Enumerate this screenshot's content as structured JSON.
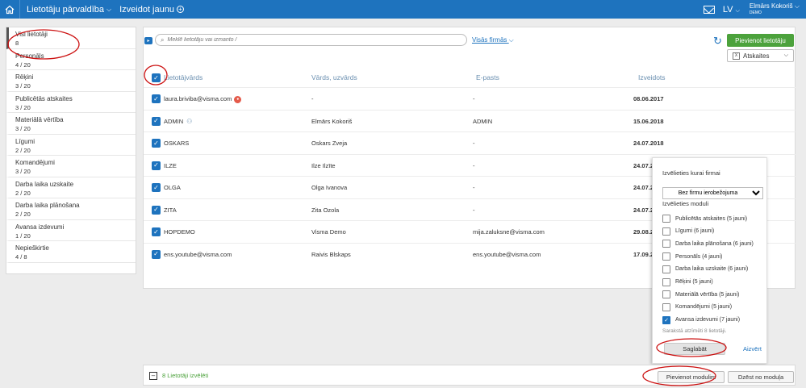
{
  "topbar": {
    "app_title": "Lietotāju pārvaldība",
    "create_new": "Izveidot jaunu",
    "language": "LV",
    "user_name": "Elmārs Kokoriš",
    "user_sub": "DEMO"
  },
  "sidebar": {
    "items": [
      {
        "label": "Visi lietotāji",
        "count": "8"
      },
      {
        "label": "Personāls",
        "count": "4 / 20"
      },
      {
        "label": "Rēķini",
        "count": "3 / 20"
      },
      {
        "label": "Publicētās atskaites",
        "count": "3 / 20"
      },
      {
        "label": "Materiālā vērtība",
        "count": "3 / 20"
      },
      {
        "label": "Līgumi",
        "count": "2 / 20"
      },
      {
        "label": "Komandējumi",
        "count": "3 / 20"
      },
      {
        "label": "Darba laika uzskaite",
        "count": "2 / 20"
      },
      {
        "label": "Darba laika plānošana",
        "count": "2 / 20"
      },
      {
        "label": "Avansa izdevumi",
        "count": "1 / 20"
      },
      {
        "label": "Nepieškirtie",
        "count": "4 / 8"
      }
    ]
  },
  "toolbar": {
    "search_placeholder": "Meklē lietotāju vai izmanto /",
    "all_firms": "Visās firmās",
    "add_user": "Pievienot lietotāju",
    "reports": "Atskaites"
  },
  "table": {
    "headers": {
      "user": "Lietotājvārds",
      "name": "Vārds, uzvārds",
      "email": "E-pasts",
      "created": "Izveidots"
    },
    "rows": [
      {
        "user": "laura.briviba@visma.com",
        "name": "-",
        "email": "-",
        "created": "08.06.2017"
      },
      {
        "user": "ADMIN",
        "name": "Elmārs Kokoriš",
        "email": "ADMIN",
        "created": "15.06.2018"
      },
      {
        "user": "OSKARS",
        "name": "Oskars Zveja",
        "email": "-",
        "created": "24.07.2018"
      },
      {
        "user": "ILZE",
        "name": "Ilze Ilzīte",
        "email": "-",
        "created": "24.07.20"
      },
      {
        "user": "OLGA",
        "name": "Olga Ivanova",
        "email": "-",
        "created": "24.07.20"
      },
      {
        "user": "ZITA",
        "name": "Zita Ozola",
        "email": "-",
        "created": "24.07.20"
      },
      {
        "user": "HOPDEMO",
        "name": "Visma Demo",
        "email": "mija.zaluksne@visma.com",
        "created": "29.08.20"
      },
      {
        "user": "ens.youtube@visma.com",
        "name": "Raivis Blskaps",
        "email": "ens.youtube@visma.com",
        "created": "17.09.20"
      }
    ]
  },
  "popup": {
    "firm_heading": "Izvēlieties kurai firmai",
    "firm_select": "Bez firmu ierobežojuma",
    "module_heading": "Izvēlieties moduli",
    "modules": [
      {
        "label": "Publicētās atskaites (5 jauni)",
        "checked": false
      },
      {
        "label": "Līgumi (6 jauni)",
        "checked": false
      },
      {
        "label": "Darba laika plānošana (6 jauni)",
        "checked": false
      },
      {
        "label": "Personāls (4 jauni)",
        "checked": false
      },
      {
        "label": "Darba laika uzskaite (6 jauni)",
        "checked": false
      },
      {
        "label": "Rēķini (5 jauni)",
        "checked": false
      },
      {
        "label": "Materiālā vērtība (5 jauni)",
        "checked": false
      },
      {
        "label": "Komandējumi (5 jauni)",
        "checked": false
      },
      {
        "label": "Avansa izdevumi (7 jauni)",
        "checked": true
      }
    ],
    "note": "Sarakstā atzīmēti 8 lietotāji.",
    "save": "Saglabāt",
    "close": "Aizvērt"
  },
  "bottom": {
    "selected": "8 Lietotāji izvēlēti",
    "add_module": "Pievienot modulim",
    "remove_module": "Dzēst no moduļa"
  },
  "colors": {
    "accent": "#1e73be",
    "green": "#4ca23c",
    "annotation": "#cc1111"
  }
}
